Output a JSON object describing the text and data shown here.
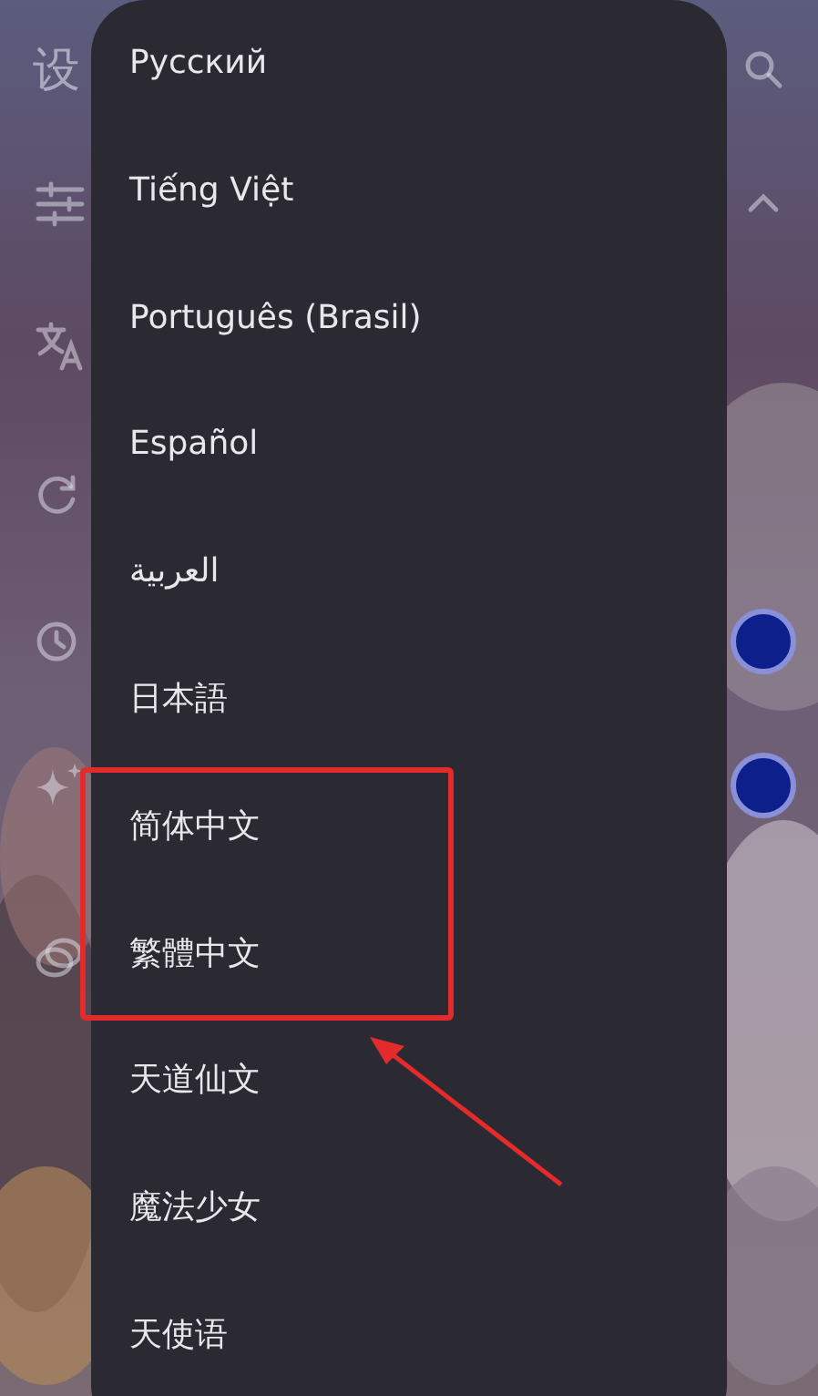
{
  "settings_page": {
    "title": "设",
    "switches": [
      {
        "on": true
      },
      {
        "on": true
      }
    ]
  },
  "language_menu": {
    "items": [
      {
        "label": "Русский"
      },
      {
        "label": "Tiếng Việt"
      },
      {
        "label": "Português (Brasil)"
      },
      {
        "label": "Español"
      },
      {
        "label": "العربية"
      },
      {
        "label": "日本語"
      },
      {
        "label": "简体中文"
      },
      {
        "label": "繁體中文"
      },
      {
        "label": "天道仙文"
      },
      {
        "label": "魔法少女"
      },
      {
        "label": "天使语"
      }
    ]
  }
}
